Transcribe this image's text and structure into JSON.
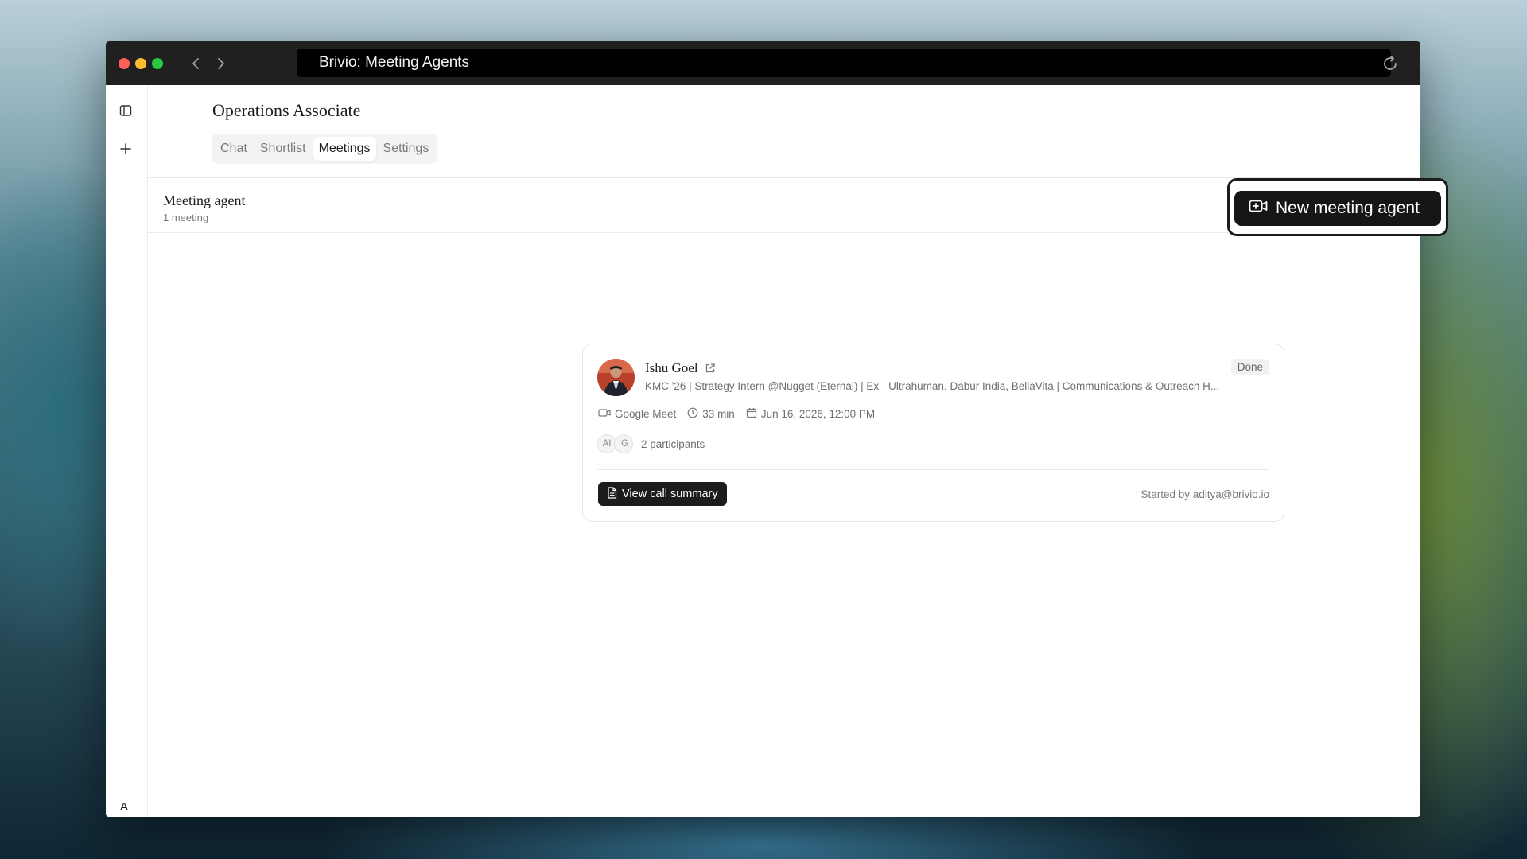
{
  "browser": {
    "url_title": "Brivio: Meeting Agents"
  },
  "sidebar": {
    "toggle_icon": "sidebar-panel-icon",
    "new_icon": "plus-icon",
    "user_initial": "A"
  },
  "header": {
    "title": "Operations Associate",
    "tabs": [
      {
        "label": "Chat",
        "active": false
      },
      {
        "label": "Shortlist",
        "active": false
      },
      {
        "label": "Meetings",
        "active": true
      },
      {
        "label": "Settings",
        "active": false
      }
    ]
  },
  "section": {
    "title": "Meeting agent",
    "subtitle": "1 meeting",
    "new_button_label": "New meeting agent"
  },
  "meeting": {
    "name": "Ishu Goel",
    "headline": "KMC '26 | Strategy Intern @Nugget (Eternal) | Ex - Ultrahuman, Dabur India, BellaVita | Communications & Outreach H...",
    "status": "Done",
    "platform": "Google Meet",
    "duration": "33 min",
    "datetime": "Jun 16, 2026, 12:00 PM",
    "participants": [
      "AI",
      "IG"
    ],
    "participants_label": "2 participants",
    "summary_button_label": "View call summary",
    "started_by": "Started by aditya@brivio.io"
  },
  "colors": {
    "accent_dark": "#161616",
    "titlebar": "#202020"
  }
}
